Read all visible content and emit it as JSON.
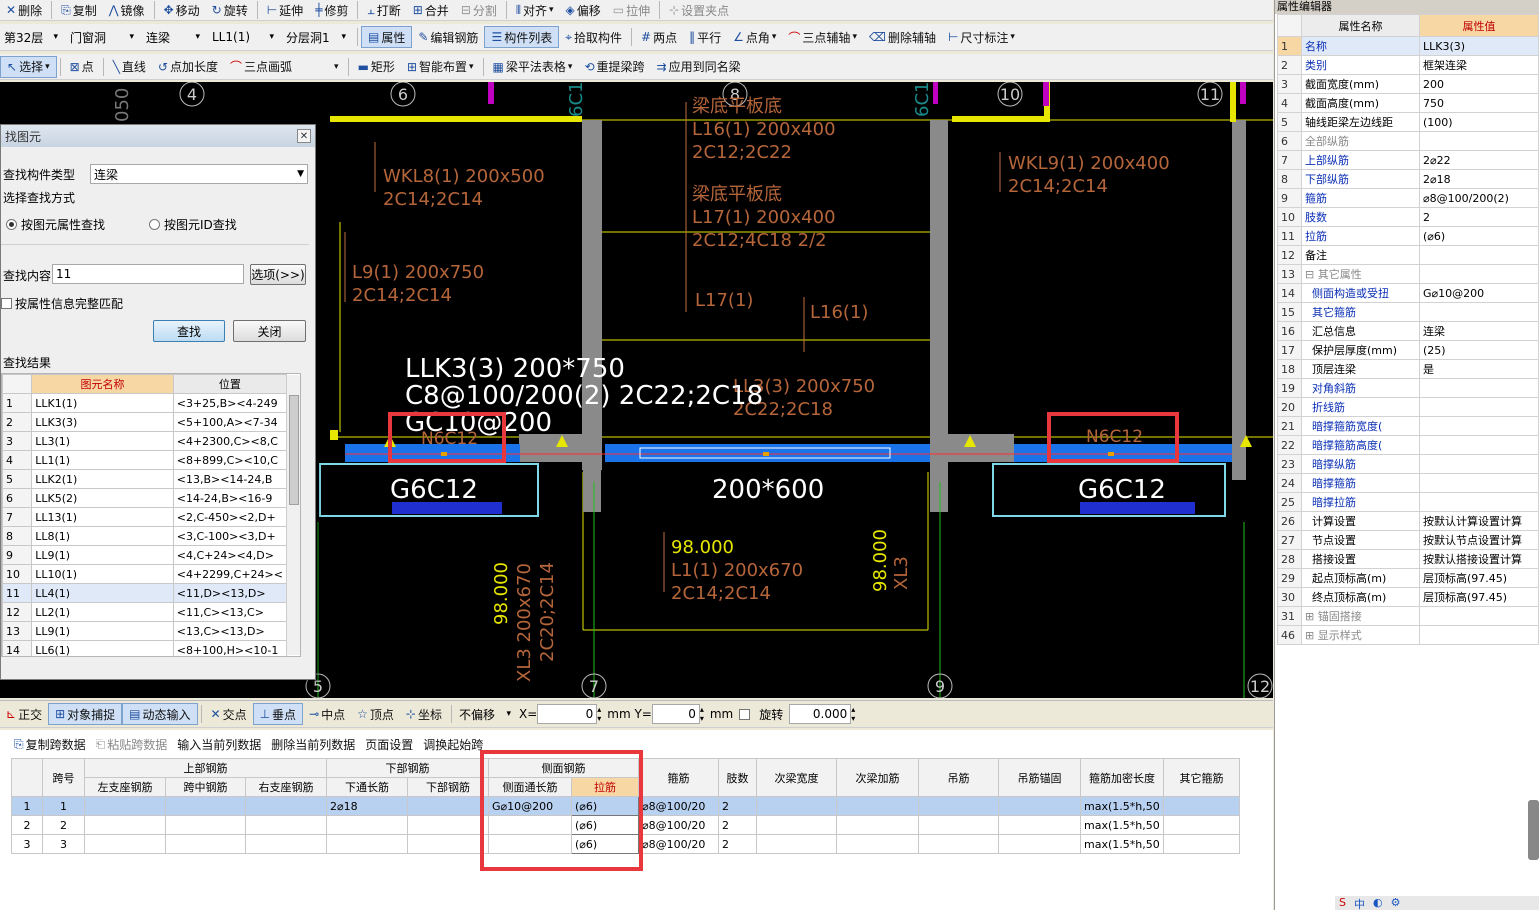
{
  "toolbar1": {
    "items": [
      "删除",
      "复制",
      "镜像",
      "移动",
      "旋转",
      "延伸",
      "修剪",
      "打断",
      "合并",
      "分割",
      "对齐",
      "偏移",
      "拉伸",
      "设置夹点"
    ]
  },
  "toolbar2": {
    "floor": "第32层",
    "category": "门窗洞",
    "type": "连梁",
    "component": "LL1(1)",
    "layer": "分层洞1",
    "items": [
      "属性",
      "编辑钢筋",
      "构件列表",
      "拾取构件",
      "两点",
      "平行",
      "点角",
      "三点辅轴",
      "删除辅轴",
      "尺寸标注"
    ]
  },
  "toolbar3": {
    "items": [
      "选择",
      "点",
      "直线",
      "点加长度",
      "三点画弧",
      "矩形",
      "智能布置",
      "梁平法表格",
      "重提梁跨",
      "应用到同名梁"
    ]
  },
  "canvas": {
    "axes": [
      "6",
      "8",
      "10",
      "11",
      "9",
      "7",
      "12",
      "5",
      "4"
    ],
    "labels": {
      "wkl8": "WKL8(1) 200x500",
      "wkl8_r": "2C14;2C14",
      "wkl9": "WKL9(1) 200x400",
      "wkl9_r": "2C14;2C14",
      "l9": "L9(1) 200x750",
      "l9_r": "2C14;2C14",
      "l16a": "梁底平板底",
      "l16b": "L16(1) 200x400",
      "l16c": "2C12;2C22",
      "l17a": "梁底平板底",
      "l17b": "L17(1) 200x400",
      "l17c": "2C12;4C18 2/2",
      "l17s": "L17(1)",
      "l16s": "L16(1)",
      "llk3a": "LLK3(3) 200*750",
      "llk3b": "C8@100/200(2) 2C22;2C18",
      "llk3c": "GC10@200",
      "ll3a": "LL3(3) 200x750",
      "ll3b": "2C22;2C18",
      "n6l": "N6C12",
      "n6r": "N6C12",
      "g6l": "G6C12",
      "g6r": "G6C12",
      "mid": "200*600",
      "el1": "98.000",
      "l1a": "L1(1) 200x670",
      "l1b": "2C14;2C14",
      "xl3": "XL3 200x670",
      "xl3r": "2C20;2C14",
      "el2": "98.000",
      "el3": "98.000",
      "xl3b": "XL3",
      "c1": "6C1",
      "c2": "6C1",
      "n050": "050"
    }
  },
  "dialog": {
    "title": "找图元",
    "type_label": "查找构件类型",
    "type_value": "连梁",
    "mode_label": "选择查找方式",
    "radio1": "按图元属性查找",
    "radio2": "按图元ID查找",
    "content_label": "查找内容:",
    "content_value": "11",
    "options_btn": "选项(>>)",
    "match_label": "按属性信息完整匹配",
    "find_btn": "查找",
    "close_btn": "关闭",
    "results_label": "查找结果",
    "col_name": "图元名称",
    "col_pos": "位置",
    "rows": [
      {
        "n": "1",
        "name": "LLK1(1)",
        "pos": "<3+25,B><4-249"
      },
      {
        "n": "2",
        "name": "LLK3(3)",
        "pos": "<5+100,A><7-34"
      },
      {
        "n": "3",
        "name": "LL3(1)",
        "pos": "<4+2300,C><8,C"
      },
      {
        "n": "4",
        "name": "LL1(1)",
        "pos": "<8+899,C><10,C"
      },
      {
        "n": "5",
        "name": "LLK2(1)",
        "pos": "<13,B><14-24,B"
      },
      {
        "n": "6",
        "name": "LLK5(2)",
        "pos": "<14-24,B><16-9"
      },
      {
        "n": "7",
        "name": "LL13(1)",
        "pos": "<2,C-450><2,D+"
      },
      {
        "n": "8",
        "name": "LL8(1)",
        "pos": "<3,C-100><3,D+"
      },
      {
        "n": "9",
        "name": "LL9(1)",
        "pos": "<4,C+24><4,D>"
      },
      {
        "n": "10",
        "name": "LL10(1)",
        "pos": "<4+2299,C+24><"
      },
      {
        "n": "11",
        "name": "LL4(1)",
        "pos": "<11,D><13,D>"
      },
      {
        "n": "12",
        "name": "LL2(1)",
        "pos": "<11,C><13,C>"
      },
      {
        "n": "13",
        "name": "LL9(1)",
        "pos": "<13,C><13,D>"
      },
      {
        "n": "14",
        "name": "LL6(1)",
        "pos": "<8+100,H><10-1"
      }
    ]
  },
  "props": {
    "title": "属性编辑器",
    "col_name": "属性名称",
    "col_value": "属性值",
    "rows": [
      {
        "n": "1",
        "name": "名称",
        "value": "LLK3(3)",
        "style": "blue"
      },
      {
        "n": "2",
        "name": "类别",
        "value": "框架连梁",
        "style": "blue"
      },
      {
        "n": "3",
        "name": "截面宽度(mm)",
        "value": "200",
        "style": ""
      },
      {
        "n": "4",
        "name": "截面高度(mm)",
        "value": "750",
        "style": ""
      },
      {
        "n": "5",
        "name": "轴线距梁左边线距",
        "value": "(100)",
        "style": ""
      },
      {
        "n": "6",
        "name": "全部纵筋",
        "value": "",
        "style": "gray"
      },
      {
        "n": "7",
        "name": "上部纵筋",
        "value": "2⌀22",
        "style": "blue"
      },
      {
        "n": "8",
        "name": "下部纵筋",
        "value": "2⌀18",
        "style": "blue"
      },
      {
        "n": "9",
        "name": "箍筋",
        "value": "⌀8@100/200(2)",
        "style": "blue"
      },
      {
        "n": "10",
        "name": "肢数",
        "value": "2",
        "style": "blue"
      },
      {
        "n": "11",
        "name": "拉筋",
        "value": "(⌀6)",
        "style": "blue"
      },
      {
        "n": "12",
        "name": "备注",
        "value": "",
        "style": ""
      },
      {
        "n": "13",
        "name": "⊟ 其它属性",
        "value": "",
        "style": "gray"
      },
      {
        "n": "14",
        "name": "  侧面构造或受扭",
        "value": "G⌀10@200",
        "style": "blue"
      },
      {
        "n": "15",
        "name": "  其它箍筋",
        "value": "",
        "style": "blue"
      },
      {
        "n": "16",
        "name": "  汇总信息",
        "value": "连梁",
        "style": ""
      },
      {
        "n": "17",
        "name": "  保护层厚度(mm)",
        "value": "(25)",
        "style": ""
      },
      {
        "n": "18",
        "name": "  顶层连梁",
        "value": "是",
        "style": ""
      },
      {
        "n": "19",
        "name": "  对角斜筋",
        "value": "",
        "style": "blue"
      },
      {
        "n": "20",
        "name": "  折线筋",
        "value": "",
        "style": "blue"
      },
      {
        "n": "21",
        "name": "  暗撑箍筋宽度(",
        "value": "",
        "style": "blue"
      },
      {
        "n": "22",
        "name": "  暗撑箍筋高度(",
        "value": "",
        "style": "blue"
      },
      {
        "n": "23",
        "name": "  暗撑纵筋",
        "value": "",
        "style": "blue"
      },
      {
        "n": "24",
        "name": "  暗撑箍筋",
        "value": "",
        "style": "blue"
      },
      {
        "n": "25",
        "name": "  暗撑拉筋",
        "value": "",
        "style": "blue"
      },
      {
        "n": "26",
        "name": "  计算设置",
        "value": "按默认计算设置计算",
        "style": ""
      },
      {
        "n": "27",
        "name": "  节点设置",
        "value": "按默认节点设置计算",
        "style": ""
      },
      {
        "n": "28",
        "name": "  搭接设置",
        "value": "按默认搭接设置计算",
        "style": ""
      },
      {
        "n": "29",
        "name": "  起点顶标高(m)",
        "value": "层顶标高(97.45)",
        "style": ""
      },
      {
        "n": "30",
        "name": "  终点顶标高(m)",
        "value": "层顶标高(97.45)",
        "style": ""
      },
      {
        "n": "31",
        "name": "⊞ 锚固搭接",
        "value": "",
        "style": "gray"
      },
      {
        "n": "46",
        "name": "⊞ 显示样式",
        "value": "",
        "style": "gray"
      }
    ]
  },
  "statusbar": {
    "items": [
      "正交",
      "对象捕捉",
      "动态输入",
      "交点",
      "垂点",
      "中点",
      "顶点",
      "坐标"
    ],
    "offset": "不偏移",
    "x_label": "X=",
    "x_val": "0",
    "y_label": "mm Y=",
    "y_val": "0",
    "unit": "mm",
    "rotate_label": "旋转",
    "rotate_val": "0.000"
  },
  "bottom_toolbar": {
    "items": [
      "复制跨数据",
      "粘贴跨数据",
      "输入当前列数据",
      "删除当前列数据",
      "页面设置",
      "调换起始跨"
    ]
  },
  "grid": {
    "h_span": "跨号",
    "h_top": "上部钢筋",
    "h_bottom": "下部钢筋",
    "h_side": "侧面钢筋",
    "h_stirrup": "箍筋",
    "h_legs": "肢数",
    "h_secw": "次梁宽度",
    "h_secadd": "次梁加筋",
    "h_hanger": "吊筋",
    "h_hanger_anc": "吊筋锚固",
    "h_dense": "箍筋加密长度",
    "h_other": "其它箍筋",
    "h_lsup": "左支座钢筋",
    "h_mid": "跨中钢筋",
    "h_rsup": "右支座钢筋",
    "h_bthru": "下通长筋",
    "h_bbar": "下部钢筋",
    "h_sthru": "侧面通长筋",
    "h_tie": "拉筋",
    "rows": [
      {
        "n": "1",
        "span": "1",
        "bthru": "2⌀18",
        "sthru": "G⌀10@200",
        "tie": "(⌀6)",
        "stirrup": "⌀8@100/20",
        "legs": "2",
        "dense": "max(1.5*h,50"
      },
      {
        "n": "2",
        "span": "2",
        "bthru": "",
        "sthru": "",
        "tie": "(⌀6)",
        "stirrup": "⌀8@100/20",
        "legs": "2",
        "dense": "max(1.5*h,50"
      },
      {
        "n": "3",
        "span": "3",
        "bthru": "",
        "sthru": "",
        "tie": "(⌀6)",
        "stirrup": "⌀8@100/20",
        "legs": "2",
        "dense": "max(1.5*h,50"
      }
    ]
  }
}
